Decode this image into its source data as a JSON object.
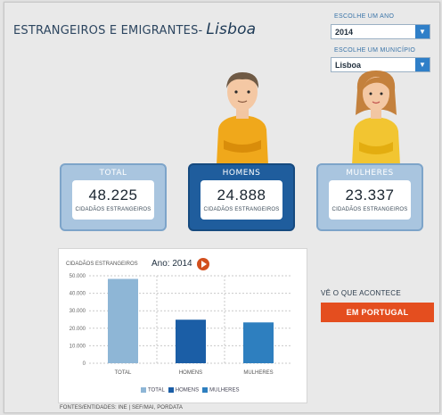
{
  "header": {
    "title": "ESTRANGEIROS E EMIGRANTES-",
    "city": "Lisboa"
  },
  "filters": {
    "year_label": "Escolhe um ano",
    "year_value": "2014",
    "municipality_label": "Escolhe um município",
    "municipality_value": "Lisboa"
  },
  "cards": {
    "total": {
      "header": "TOTAL",
      "value": "48.225",
      "sub": "Cidadãos estrangeiros"
    },
    "men": {
      "header": "HOMENS",
      "value": "24.888",
      "sub": "Cidadãos estrangeiros"
    },
    "women": {
      "header": "MULHERES",
      "value": "23.337",
      "sub": "Cidadãos estrangeiros"
    }
  },
  "chart_data": {
    "type": "bar",
    "ylabel": "Cidadãos estrangeiros",
    "year_label": "Ano: 2014",
    "categories": [
      "Total",
      "Homens",
      "Mulheres"
    ],
    "values": [
      48225,
      24888,
      23337
    ],
    "yticks": [
      "50.000",
      "40.000",
      "30.000",
      "20.000",
      "10.000",
      "0"
    ],
    "ylim": [
      0,
      50000
    ],
    "colors": [
      "#8eb6d6",
      "#1b5ea6",
      "#2e7fbf"
    ],
    "legend": [
      "Total",
      "Homens",
      "Mulheres"
    ],
    "grid": true
  },
  "cta": {
    "prompt": "Vê o que acontece",
    "button": "EM PORTUGAL"
  },
  "footer": {
    "source": "Fontes/Entidades: INE | SEF/MAI, PORDATA"
  }
}
